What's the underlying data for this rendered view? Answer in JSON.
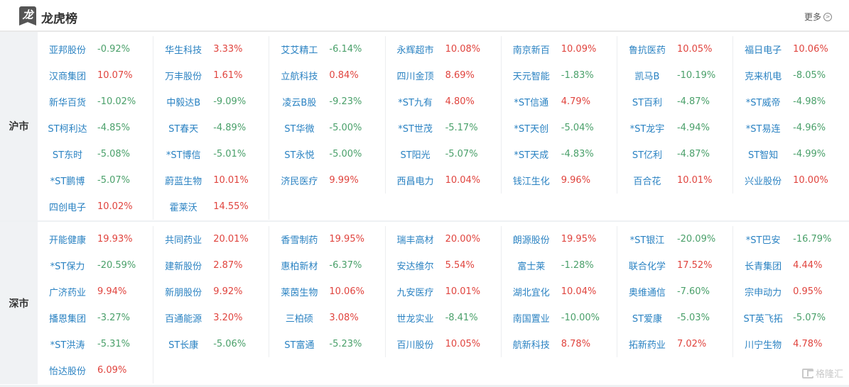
{
  "header": {
    "logo_glyph": "龙",
    "title": "龙虎榜",
    "more_label": "更多",
    "more_icon": "chevron-right-circle-icon"
  },
  "colors": {
    "up": "#e0443e",
    "down": "#4aa06a",
    "stock_name": "#2a82c2"
  },
  "markets": [
    {
      "label": "沪市",
      "stocks": [
        {
          "name": "亚邦股份",
          "pct": "-0.92%"
        },
        {
          "name": "华生科技",
          "pct": "3.33%"
        },
        {
          "name": "艾艾精工",
          "pct": "-6.14%"
        },
        {
          "name": "永辉超市",
          "pct": "10.08%"
        },
        {
          "name": "南京新百",
          "pct": "10.09%"
        },
        {
          "name": "鲁抗医药",
          "pct": "10.05%"
        },
        {
          "name": "福日电子",
          "pct": "10.06%"
        },
        {
          "name": "汉商集团",
          "pct": "10.07%"
        },
        {
          "name": "万丰股份",
          "pct": "1.61%"
        },
        {
          "name": "立航科技",
          "pct": "0.84%"
        },
        {
          "name": "四川金顶",
          "pct": "8.69%"
        },
        {
          "name": "天元智能",
          "pct": "-1.83%"
        },
        {
          "name": "凯马B",
          "pct": "-10.19%"
        },
        {
          "name": "克来机电",
          "pct": "-8.05%"
        },
        {
          "name": "新华百货",
          "pct": "-10.02%"
        },
        {
          "name": "中毅达B",
          "pct": "-9.09%"
        },
        {
          "name": "凌云B股",
          "pct": "-9.23%"
        },
        {
          "name": "*ST九有",
          "pct": "4.80%"
        },
        {
          "name": "*ST信通",
          "pct": "4.79%"
        },
        {
          "name": "ST百利",
          "pct": "-4.87%"
        },
        {
          "name": "*ST威帝",
          "pct": "-4.98%"
        },
        {
          "name": "ST柯利达",
          "pct": "-4.85%"
        },
        {
          "name": "ST春天",
          "pct": "-4.89%"
        },
        {
          "name": "ST华微",
          "pct": "-5.00%"
        },
        {
          "name": "*ST世茂",
          "pct": "-5.17%"
        },
        {
          "name": "*ST天创",
          "pct": "-5.04%"
        },
        {
          "name": "*ST龙宇",
          "pct": "-4.94%"
        },
        {
          "name": "*ST易连",
          "pct": "-4.96%"
        },
        {
          "name": "ST东时",
          "pct": "-5.08%"
        },
        {
          "name": "*ST博信",
          "pct": "-5.01%"
        },
        {
          "name": "ST永悦",
          "pct": "-5.00%"
        },
        {
          "name": "ST阳光",
          "pct": "-5.07%"
        },
        {
          "name": "*ST天成",
          "pct": "-4.83%"
        },
        {
          "name": "ST亿利",
          "pct": "-4.87%"
        },
        {
          "name": "ST智知",
          "pct": "-4.99%"
        },
        {
          "name": "*ST鹏博",
          "pct": "-5.07%"
        },
        {
          "name": "蔚蓝生物",
          "pct": "10.01%"
        },
        {
          "name": "济民医疗",
          "pct": "9.99%"
        },
        {
          "name": "西昌电力",
          "pct": "10.04%"
        },
        {
          "name": "钱江生化",
          "pct": "9.96%"
        },
        {
          "name": "百合花",
          "pct": "10.01%"
        },
        {
          "name": "兴业股份",
          "pct": "10.00%"
        },
        {
          "name": "四创电子",
          "pct": "10.02%"
        },
        {
          "name": "霍莱沃",
          "pct": "14.55%"
        }
      ]
    },
    {
      "label": "深市",
      "stocks": [
        {
          "name": "开能健康",
          "pct": "19.93%"
        },
        {
          "name": "共同药业",
          "pct": "20.01%"
        },
        {
          "name": "香雪制药",
          "pct": "19.95%"
        },
        {
          "name": "瑞丰高材",
          "pct": "20.00%"
        },
        {
          "name": "朗源股份",
          "pct": "19.95%"
        },
        {
          "name": "*ST银江",
          "pct": "-20.09%"
        },
        {
          "name": "*ST巴安",
          "pct": "-16.79%"
        },
        {
          "name": "*ST保力",
          "pct": "-20.59%"
        },
        {
          "name": "建新股份",
          "pct": "2.87%"
        },
        {
          "name": "惠柏新材",
          "pct": "-6.37%"
        },
        {
          "name": "安达维尔",
          "pct": "5.54%"
        },
        {
          "name": "富士莱",
          "pct": "-1.28%"
        },
        {
          "name": "联合化学",
          "pct": "17.52%"
        },
        {
          "name": "长青集团",
          "pct": "4.44%"
        },
        {
          "name": "广济药业",
          "pct": "9.94%"
        },
        {
          "name": "新朋股份",
          "pct": "9.92%"
        },
        {
          "name": "莱茵生物",
          "pct": "10.06%"
        },
        {
          "name": "九安医疗",
          "pct": "10.01%"
        },
        {
          "name": "湖北宜化",
          "pct": "10.04%"
        },
        {
          "name": "奥维通信",
          "pct": "-7.60%"
        },
        {
          "name": "宗申动力",
          "pct": "0.95%"
        },
        {
          "name": "播恩集团",
          "pct": "-3.27%"
        },
        {
          "name": "百通能源",
          "pct": "3.20%"
        },
        {
          "name": "三柏硕",
          "pct": "3.08%"
        },
        {
          "name": "世龙实业",
          "pct": "-8.41%"
        },
        {
          "name": "南国置业",
          "pct": "-10.00%"
        },
        {
          "name": "ST爱康",
          "pct": "-5.03%"
        },
        {
          "name": "ST英飞拓",
          "pct": "-5.07%"
        },
        {
          "name": "*ST洪涛",
          "pct": "-5.31%"
        },
        {
          "name": "ST长康",
          "pct": "-5.06%"
        },
        {
          "name": "ST富通",
          "pct": "-5.23%"
        },
        {
          "name": "百川股份",
          "pct": "10.05%"
        },
        {
          "name": "航新科技",
          "pct": "8.78%"
        },
        {
          "name": "拓新药业",
          "pct": "7.02%"
        },
        {
          "name": "川宁生物",
          "pct": "4.78%"
        },
        {
          "name": "怡达股份",
          "pct": "6.09%"
        }
      ]
    }
  ],
  "watermark": {
    "icon": "gelonghui-logo-icon",
    "text": "格隆汇"
  }
}
